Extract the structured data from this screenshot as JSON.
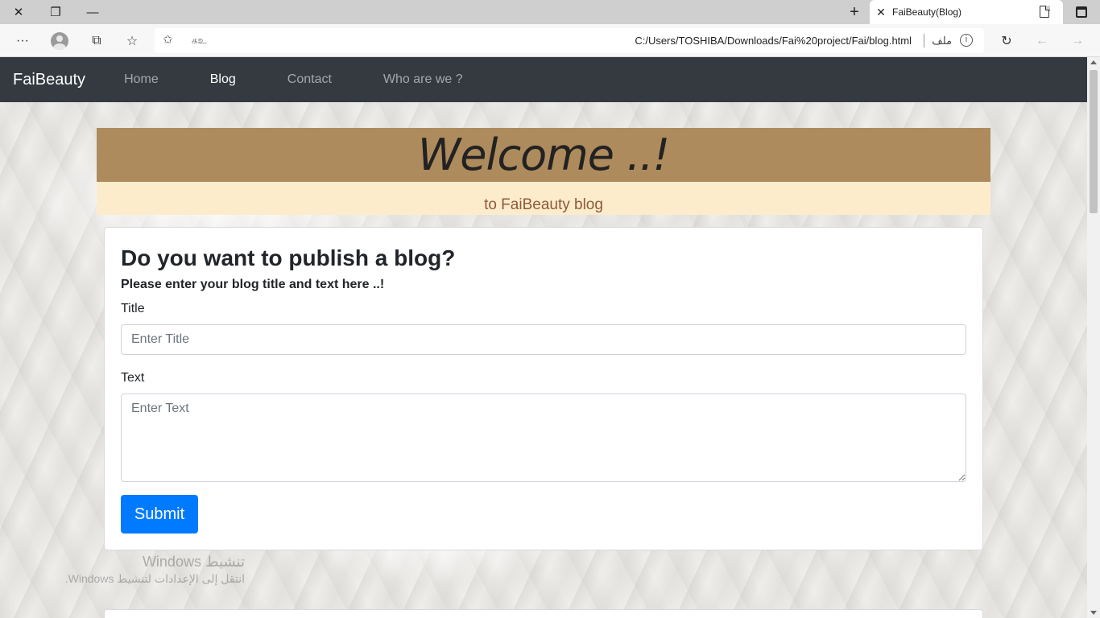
{
  "browser": {
    "tab_title": "FaiBeauty(Blog)",
    "tab_close": "✕",
    "new_tab": "+",
    "address_url": "C:/Users/TOSHIBA/Downloads/Fai%20project/Fai/blog.html",
    "address_file_label": "ملف",
    "address_lang": "கஉ",
    "info_glyph": "i",
    "window_close": "✕",
    "window_restore": "❐",
    "window_minimize": "—",
    "more_glyph": "···",
    "refresh_glyph": "↻",
    "back_glyph": "←",
    "forward_glyph": "→",
    "collections_glyph": "⧉",
    "favorites_glyph": "☆",
    "add_fav_glyph": "✩"
  },
  "nav": {
    "brand": "FaiBeauty",
    "items": [
      {
        "label": "Home",
        "active": false
      },
      {
        "label": "Blog",
        "active": true
      },
      {
        "label": "Contact",
        "active": false
      },
      {
        "label": "Who are we ?",
        "active": false
      }
    ]
  },
  "hero": {
    "welcome": "Welcome ..!",
    "subtitle": "to FaiBeauty blog",
    "band_color": "#ae8b5d",
    "sub_band_color": "#fdeccb"
  },
  "form": {
    "heading": "Do you want to publish a blog?",
    "instruction": "Please enter your blog title and text here ..!",
    "title_label": "Title",
    "title_placeholder": "Enter Title",
    "text_label": "Text",
    "text_placeholder": "Enter Text",
    "submit_label": "Submit",
    "submit_color": "#007bff"
  },
  "watermark": {
    "line1": "تنشيط Windows",
    "line2": "انتقل إلى الإعدادات لتنشيط Windows."
  }
}
